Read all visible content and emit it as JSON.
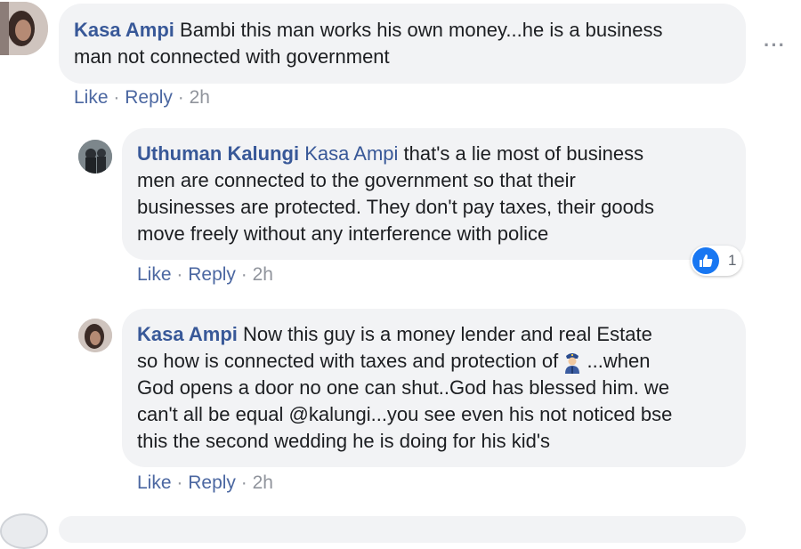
{
  "comments": [
    {
      "author": "Kasa Ampi",
      "line1": "Bambi this man works his own money...he is a business",
      "line2": "man not connected with government",
      "actions": {
        "like": "Like",
        "reply": "Reply",
        "time": "2h",
        "sep": "·"
      }
    },
    {
      "author": "Uthuman Kalungi",
      "mention": "Kasa Ampi",
      "line1_rest": " that's a lie most of business",
      "line2": "men are connected to the government so that their",
      "line3": "businesses are protected. They don't pay taxes, their goods",
      "line4": "move freely without any interference with police",
      "actions": {
        "like": "Like",
        "reply": "Reply",
        "time": "2h",
        "sep": "·"
      },
      "reaction": {
        "icon": "thumbs-up-icon",
        "count": "1"
      }
    },
    {
      "author": "Kasa Ampi",
      "line1_rest": " Now this guy is a money lender and real Estate",
      "line2_a": "so how is connected with taxes and protection of",
      "line2_b": "...when",
      "line3": "God opens a door no one can shut..God has blessed him. we",
      "line4": "can't all be equal @kalungi...you see even his not noticed bse",
      "line5": "this the second wedding he is doing for his kid's",
      "emoji": "police-officer-emoji",
      "actions": {
        "like": "Like",
        "reply": "Reply",
        "time": "2h",
        "sep": "·"
      }
    }
  ],
  "menu": {
    "icon": "more-options-icon",
    "label": "···"
  },
  "colors": {
    "name": "#385898",
    "bubble": "#f2f3f5",
    "meta": "#90949c",
    "like": "#1877f2"
  }
}
